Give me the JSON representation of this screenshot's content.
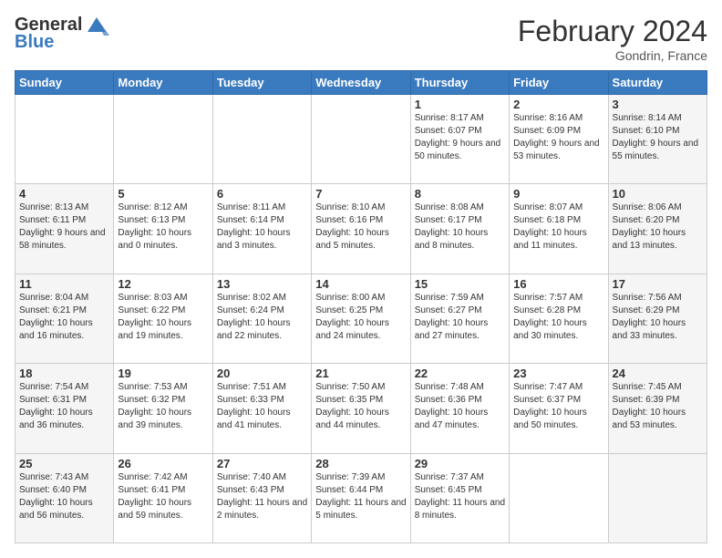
{
  "header": {
    "logo_line1": "General",
    "logo_line2": "Blue",
    "month_title": "February 2024",
    "location": "Gondrin, France"
  },
  "weekdays": [
    "Sunday",
    "Monday",
    "Tuesday",
    "Wednesday",
    "Thursday",
    "Friday",
    "Saturday"
  ],
  "weeks": [
    [
      {
        "day": "",
        "info": "",
        "shaded": false
      },
      {
        "day": "",
        "info": "",
        "shaded": false
      },
      {
        "day": "",
        "info": "",
        "shaded": false
      },
      {
        "day": "",
        "info": "",
        "shaded": false
      },
      {
        "day": "1",
        "info": "Sunrise: 8:17 AM\nSunset: 6:07 PM\nDaylight: 9 hours\nand 50 minutes.",
        "shaded": false
      },
      {
        "day": "2",
        "info": "Sunrise: 8:16 AM\nSunset: 6:09 PM\nDaylight: 9 hours\nand 53 minutes.",
        "shaded": false
      },
      {
        "day": "3",
        "info": "Sunrise: 8:14 AM\nSunset: 6:10 PM\nDaylight: 9 hours\nand 55 minutes.",
        "shaded": true
      }
    ],
    [
      {
        "day": "4",
        "info": "Sunrise: 8:13 AM\nSunset: 6:11 PM\nDaylight: 9 hours\nand 58 minutes.",
        "shaded": true
      },
      {
        "day": "5",
        "info": "Sunrise: 8:12 AM\nSunset: 6:13 PM\nDaylight: 10 hours\nand 0 minutes.",
        "shaded": false
      },
      {
        "day": "6",
        "info": "Sunrise: 8:11 AM\nSunset: 6:14 PM\nDaylight: 10 hours\nand 3 minutes.",
        "shaded": false
      },
      {
        "day": "7",
        "info": "Sunrise: 8:10 AM\nSunset: 6:16 PM\nDaylight: 10 hours\nand 5 minutes.",
        "shaded": false
      },
      {
        "day": "8",
        "info": "Sunrise: 8:08 AM\nSunset: 6:17 PM\nDaylight: 10 hours\nand 8 minutes.",
        "shaded": false
      },
      {
        "day": "9",
        "info": "Sunrise: 8:07 AM\nSunset: 6:18 PM\nDaylight: 10 hours\nand 11 minutes.",
        "shaded": false
      },
      {
        "day": "10",
        "info": "Sunrise: 8:06 AM\nSunset: 6:20 PM\nDaylight: 10 hours\nand 13 minutes.",
        "shaded": true
      }
    ],
    [
      {
        "day": "11",
        "info": "Sunrise: 8:04 AM\nSunset: 6:21 PM\nDaylight: 10 hours\nand 16 minutes.",
        "shaded": true
      },
      {
        "day": "12",
        "info": "Sunrise: 8:03 AM\nSunset: 6:22 PM\nDaylight: 10 hours\nand 19 minutes.",
        "shaded": false
      },
      {
        "day": "13",
        "info": "Sunrise: 8:02 AM\nSunset: 6:24 PM\nDaylight: 10 hours\nand 22 minutes.",
        "shaded": false
      },
      {
        "day": "14",
        "info": "Sunrise: 8:00 AM\nSunset: 6:25 PM\nDaylight: 10 hours\nand 24 minutes.",
        "shaded": false
      },
      {
        "day": "15",
        "info": "Sunrise: 7:59 AM\nSunset: 6:27 PM\nDaylight: 10 hours\nand 27 minutes.",
        "shaded": false
      },
      {
        "day": "16",
        "info": "Sunrise: 7:57 AM\nSunset: 6:28 PM\nDaylight: 10 hours\nand 30 minutes.",
        "shaded": false
      },
      {
        "day": "17",
        "info": "Sunrise: 7:56 AM\nSunset: 6:29 PM\nDaylight: 10 hours\nand 33 minutes.",
        "shaded": true
      }
    ],
    [
      {
        "day": "18",
        "info": "Sunrise: 7:54 AM\nSunset: 6:31 PM\nDaylight: 10 hours\nand 36 minutes.",
        "shaded": true
      },
      {
        "day": "19",
        "info": "Sunrise: 7:53 AM\nSunset: 6:32 PM\nDaylight: 10 hours\nand 39 minutes.",
        "shaded": false
      },
      {
        "day": "20",
        "info": "Sunrise: 7:51 AM\nSunset: 6:33 PM\nDaylight: 10 hours\nand 41 minutes.",
        "shaded": false
      },
      {
        "day": "21",
        "info": "Sunrise: 7:50 AM\nSunset: 6:35 PM\nDaylight: 10 hours\nand 44 minutes.",
        "shaded": false
      },
      {
        "day": "22",
        "info": "Sunrise: 7:48 AM\nSunset: 6:36 PM\nDaylight: 10 hours\nand 47 minutes.",
        "shaded": false
      },
      {
        "day": "23",
        "info": "Sunrise: 7:47 AM\nSunset: 6:37 PM\nDaylight: 10 hours\nand 50 minutes.",
        "shaded": false
      },
      {
        "day": "24",
        "info": "Sunrise: 7:45 AM\nSunset: 6:39 PM\nDaylight: 10 hours\nand 53 minutes.",
        "shaded": true
      }
    ],
    [
      {
        "day": "25",
        "info": "Sunrise: 7:43 AM\nSunset: 6:40 PM\nDaylight: 10 hours\nand 56 minutes.",
        "shaded": true
      },
      {
        "day": "26",
        "info": "Sunrise: 7:42 AM\nSunset: 6:41 PM\nDaylight: 10 hours\nand 59 minutes.",
        "shaded": false
      },
      {
        "day": "27",
        "info": "Sunrise: 7:40 AM\nSunset: 6:43 PM\nDaylight: 11 hours\nand 2 minutes.",
        "shaded": false
      },
      {
        "day": "28",
        "info": "Sunrise: 7:39 AM\nSunset: 6:44 PM\nDaylight: 11 hours\nand 5 minutes.",
        "shaded": false
      },
      {
        "day": "29",
        "info": "Sunrise: 7:37 AM\nSunset: 6:45 PM\nDaylight: 11 hours\nand 8 minutes.",
        "shaded": false
      },
      {
        "day": "",
        "info": "",
        "shaded": false
      },
      {
        "day": "",
        "info": "",
        "shaded": true
      }
    ]
  ]
}
